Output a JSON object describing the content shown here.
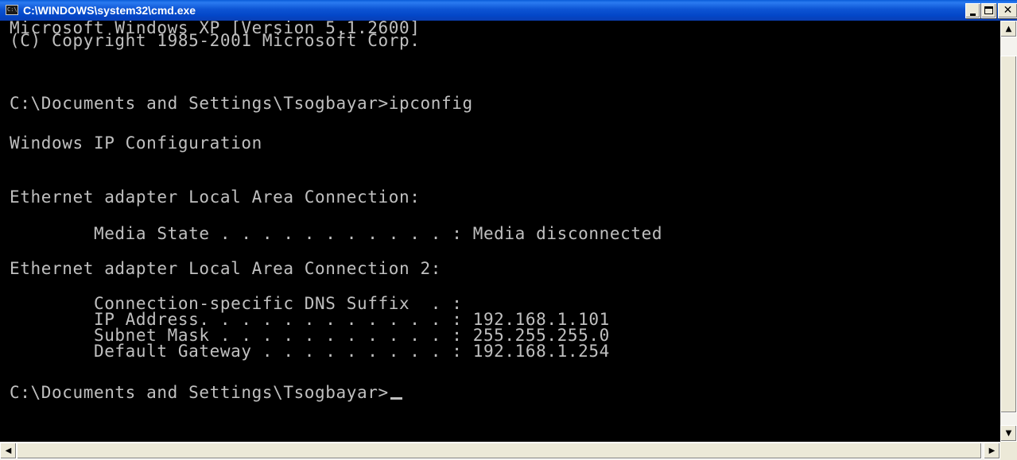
{
  "window": {
    "title": "C:\\WINDOWS\\system32\\cmd.exe",
    "icon": "cmd-icon",
    "icon_text": "C:\\"
  },
  "console": {
    "lines": [
      "Microsoft Windows XP [Version 5.1.2600]",
      "(C) Copyright 1985-2001 Microsoft Corp.",
      "C:\\Documents and Settings\\Tsogbayar>ipconfig",
      "Windows IP Configuration",
      "Ethernet adapter Local Area Connection:",
      "        Media State . . . . . . . . . . . : Media disconnected",
      "Ethernet adapter Local Area Connection 2:",
      "        Connection-specific DNS Suffix  . :",
      "        IP Address. . . . . . . . . . . . : 192.168.1.101",
      "        Subnet Mask . . . . . . . . . . . : 255.255.255.0",
      "        Default Gateway . . . . . . . . . : 192.168.1.254",
      "C:\\Documents and Settings\\Tsogbayar>"
    ]
  },
  "scrollbars": {
    "up": "▲",
    "down": "▼",
    "left": "◀",
    "right": "▶"
  },
  "colors": {
    "titlebar": "#0347c8",
    "console_bg": "#000000",
    "console_fg": "#c0c0c0"
  }
}
